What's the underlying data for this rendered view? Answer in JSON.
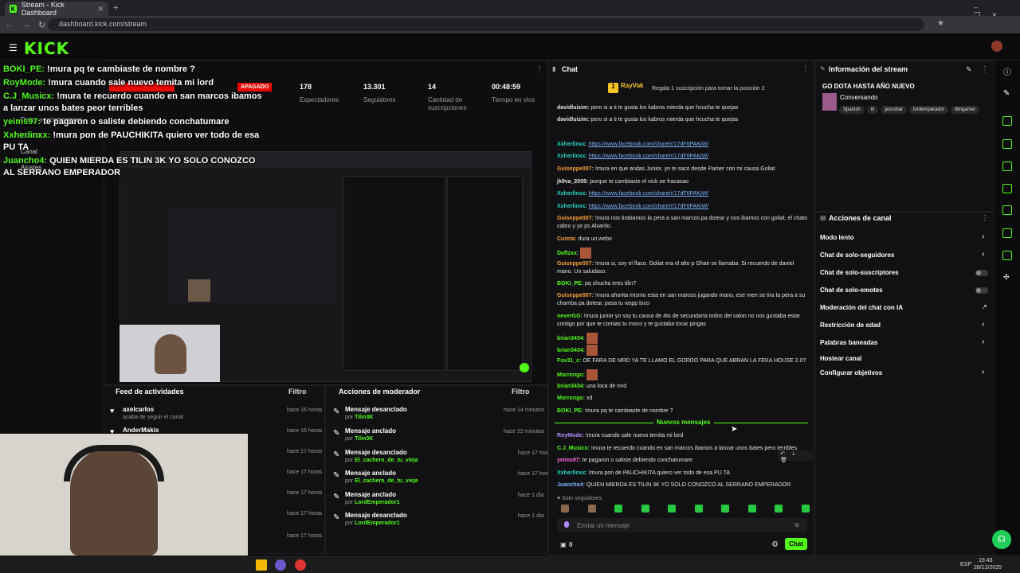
{
  "browser": {
    "tab_title": "Stream - Kick Dashboard",
    "url": "dashboard.kick.com/stream"
  },
  "kick": {
    "logo": "KICK"
  },
  "stream_stats": {
    "status": "APAGADO",
    "viewers_value": "178",
    "viewers_label": "Espectadores",
    "followers_value": "13.301",
    "followers_label": "Seguidores",
    "subs_value": "14",
    "subs_label": "Cantidad de suscripciones",
    "time_value": "00:48:59",
    "time_label": "Tiempo en vivo"
  },
  "overlay_chat": [
    {
      "name": "BOKI_PE:",
      "text": " !mura pq te cambiaste de nombre ?"
    },
    {
      "name": "RoyMode:",
      "text": " !mura cuando sale nuevo temita mi lord"
    },
    {
      "name": "C.J_Musicx:",
      "text": " !mura te recuerdo cuando en san marcos ibamos a lanzar unos bates peor terribles"
    },
    {
      "name": "yeims97:",
      "text": " te pagaron o saliste debiendo conchatumare"
    },
    {
      "name": "Xxherlinxx:",
      "text": " !mura pon de PAUCHIKITA quiero ver todo de esa PU TA"
    },
    {
      "name": "Juancho4:",
      "text": " QUIEN MIERDA ES TILIN 3K YO SOLO CONOZCO AL SERRANO EMPERADOR"
    }
  ],
  "sidebar_ghost": {
    "item1": "Drops y recompensas",
    "item2": "Estudio",
    "item3": "Canal",
    "item4": "Ajustes"
  },
  "chat": {
    "header": "Chat",
    "top_user": "RayVak",
    "top_msg": "Regala 1 suscripción para tomar la posición 2",
    "new_messages": "Nuevos mensajes",
    "followers_only": "Solo seguidores",
    "input_placeholder": "Enviar un mensaje",
    "send_label": "Chat",
    "count": "0",
    "messages": [
      {
        "name": "davidluizim:",
        "color": "#dfe1e5",
        "text": "pero si a ti te gusta los kabros mierda que hcucha te quejas"
      },
      {
        "name": "davidluizim:",
        "color": "#dfe1e5",
        "text": "pero si a ti te gusta los kabros mierda que hcucha te quejas"
      },
      {
        "name": "Xxherlinxx:",
        "color": "#1fd7c7",
        "text": "https://www.facebook.com/share/r/17dF6PAKjW/",
        "link": true
      },
      {
        "name": "Xxherlinxx:",
        "color": "#1fd7c7",
        "text": "https://www.facebook.com/share/r/17dF6PAKjW/",
        "link": true
      },
      {
        "name": "Guiseppe007:",
        "color": "#f7a13b",
        "text": "!mura en que andas Junior, yo te saco desde Pamer con mi causa Goliat"
      },
      {
        "name": "jk9va_2005:",
        "color": "#dfe1e5",
        "text": "porque te cambiaste el nick oe fracasao"
      },
      {
        "name": "Xxherlinxx:",
        "color": "#1fd7c7",
        "text": "https://www.facebook.com/share/r/17dF6PAKjW/",
        "link": true
      },
      {
        "name": "Xxherlinxx:",
        "color": "#1fd7c7",
        "text": "https://www.facebook.com/share/r/17dF6PAKjW/",
        "link": true
      },
      {
        "name": "Guiseppe007:",
        "color": "#f7a13b",
        "text": "!mura nos tirabamos la pera a san marcos pa dotear y nos ibamos con goliat, el chato cabro y yo ps Alvarito."
      },
      {
        "name": "Cureta:",
        "color": "#f7a13b",
        "text": "dura un webo"
      },
      {
        "name": "Daftzxx:",
        "color": "#53fc18",
        "text": ""
      },
      {
        "name": "Guiseppe007:",
        "color": "#f7a13b",
        "text": "!mura si, soy el flaco. Goliat era el alto p Ghair se llamaba. Si recuerdo de daniel mano. Un saludaso."
      },
      {
        "name": "BOKI_PE:",
        "color": "#53fc18",
        "text": "pq chucha eres tilin?"
      },
      {
        "name": "Guiseppe007:",
        "color": "#f7a13b",
        "text": "!mura ahorita mismo esta en san marcos jugando mano, ese men se tira la pera a su chamba pa dotear, pasa tu wspp loco"
      },
      {
        "name": "neverGG:",
        "color": "#53fc18",
        "text": "!mura junior yo soy tu causa de 4to de secundaria todos del salon no nos gustaba estar contigo por que te comias tu moco y te gustaba tocar pingas"
      },
      {
        "name": "brian3434:",
        "color": "#53fc18",
        "text": ""
      },
      {
        "name": "brian3434:",
        "color": "#53fc18",
        "text": ""
      },
      {
        "name": "Fox31_c:",
        "color": "#53fc18",
        "text": "OE FARA DE MRD YA TE LLAMO EL GORDO PARA QUE ABRAN LA FEKA HOUSE 2.0?"
      },
      {
        "name": "Morrongo:",
        "color": "#53fc18",
        "text": ""
      },
      {
        "name": "brian3434:",
        "color": "#53fc18",
        "text": "una loca de mrd"
      },
      {
        "name": "Morrongo:",
        "color": "#53fc18",
        "text": "xd"
      },
      {
        "name": "BOKI_PE:",
        "color": "#53fc18",
        "text": "!mura pq te cambiaste de nombre ?"
      }
    ],
    "new_msgs": [
      {
        "name": "RoyMode:",
        "color": "#b58cff",
        "text": "!mura cuando sale nuevo temita mi lord"
      },
      {
        "name": "C.J_Musicx:",
        "color": "#53fc18",
        "text": "!mura te recuerdo cuando en san marcos ibamos a lanzar unos bates pero terribles"
      },
      {
        "name": "yeims97:",
        "color": "#ff6ad5",
        "text": "te pagaron o saliste debiendo conchatumare"
      },
      {
        "name": "Xxherlinxx:",
        "color": "#1fd7c7",
        "text": "!mura pon de PAUCHIKITA quiero ver todo de esa PU TA"
      },
      {
        "name": "Juancho4:",
        "color": "#7fb2ff",
        "text": "QUIEN MIERDA ES TILIN 3K YO SOLO CONOZCO AL SERRANO EMPERADOR"
      }
    ]
  },
  "stream_info": {
    "header": "Información del stream",
    "title": "GO DOTA HASTA AÑO NUEVO",
    "category": "Conversando",
    "tags": [
      "Spanish",
      "irl",
      "jescobar",
      "lordemperador",
      "tilingamer"
    ]
  },
  "channel_actions": {
    "header": "Acciones de canal",
    "items": [
      {
        "label": "Modo lento",
        "kind": "arrow"
      },
      {
        "label": "Chat de solo-seguidores",
        "kind": "arrow"
      },
      {
        "label": "Chat de solo-suscriptores",
        "kind": "toggle"
      },
      {
        "label": "Chat de solo-emotes",
        "kind": "toggle"
      },
      {
        "label": "Moderación del chat con IA",
        "kind": "ext"
      },
      {
        "label": "Restricción de edad",
        "kind": "arrow"
      },
      {
        "label": "Palabras baneadas",
        "kind": "arrow"
      },
      {
        "label": "Hostear canal",
        "kind": "none"
      },
      {
        "label": "Configurar objetivos",
        "kind": "arrow"
      }
    ]
  },
  "activity_feed": {
    "header": "Feed de actividades",
    "filter": "Filtro",
    "items": [
      {
        "name": "axelcarlos",
        "sub": "acaba de seguir el canal",
        "time": "hace 16 horas"
      },
      {
        "name": "AnderMakis",
        "sub": "",
        "time": "hace 16 horas"
      },
      {
        "name": "",
        "sub": "",
        "time": "hace 17 horas"
      },
      {
        "name": "",
        "sub": "",
        "time": "hace 17 horas"
      },
      {
        "name": "",
        "sub": "",
        "time": "hace 17 horas"
      },
      {
        "name": "",
        "sub": "",
        "time": "hace 17 horas"
      },
      {
        "name": "",
        "sub": "",
        "time": "hace 17 horas"
      }
    ]
  },
  "mod_actions": {
    "header": "Acciones de moderador",
    "filter": "Filtro",
    "items": [
      {
        "title": "Mensaje desanclado",
        "by": "por",
        "user": "Tilin3K",
        "time": "hace 14 minutos"
      },
      {
        "title": "Mensaje anclado",
        "by": "por",
        "user": "Tilin3K",
        "time": "hace 22 minutos"
      },
      {
        "title": "Mensaje desanclado",
        "by": "por",
        "user": "El_cachero_de_tu_vieja",
        "time": "hace 17 horas"
      },
      {
        "title": "Mensaje anclado",
        "by": "por",
        "user": "El_cachero_de_tu_vieja",
        "time": "hace 17 horas"
      },
      {
        "title": "Mensaje anclado",
        "by": "por",
        "user": "LordEmperador1",
        "time": "hace 1 día"
      },
      {
        "title": "Mensaje desanclado",
        "by": "por",
        "user": "LordEmperador1",
        "time": "hace 1 día"
      }
    ]
  },
  "taskbar": {
    "lang": "ESP",
    "time": "15:43",
    "date": "28/12/2025"
  },
  "colors": {
    "accent": "#53fc18",
    "bg": "#0e0e10",
    "live_red": "#eb0400"
  }
}
